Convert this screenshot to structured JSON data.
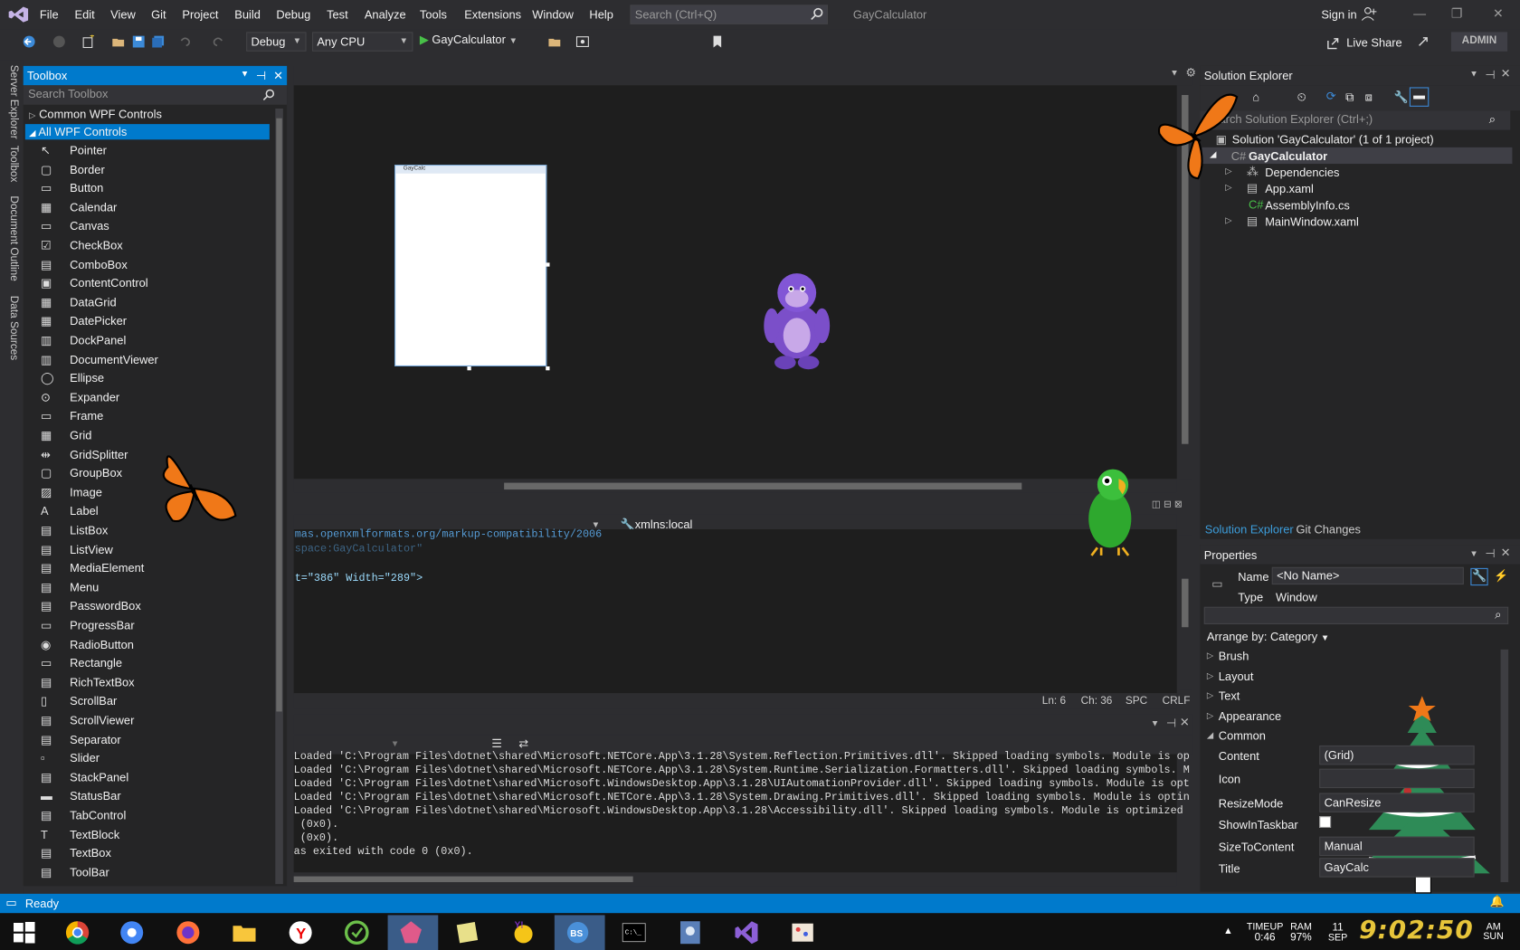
{
  "menu": [
    "File",
    "Edit",
    "View",
    "Git",
    "Project",
    "Build",
    "Debug",
    "Test",
    "Analyze",
    "Tools",
    "Extensions",
    "Window",
    "Help"
  ],
  "search_placeholder": "Search (Ctrl+Q)",
  "solution_name": "GayCalculator",
  "signin": "Sign in",
  "toolbar": {
    "config": "Debug",
    "platform": "Any CPU",
    "start": "GayCalculator",
    "liveshare": "Live Share",
    "user": "ADMIN"
  },
  "rail": [
    "Server Explorer",
    "Toolbox",
    "Document Outline",
    "Data Sources"
  ],
  "toolbox": {
    "title": "Toolbox",
    "search": "Search Toolbox",
    "cat_common": "Common WPF Controls",
    "cat_all": "All WPF Controls",
    "items": [
      "Pointer",
      "Border",
      "Button",
      "Calendar",
      "Canvas",
      "CheckBox",
      "ComboBox",
      "ContentControl",
      "DataGrid",
      "DatePicker",
      "DockPanel",
      "DocumentViewer",
      "Ellipse",
      "Expander",
      "Frame",
      "Grid",
      "GridSplitter",
      "GroupBox",
      "Image",
      "Label",
      "ListBox",
      "ListView",
      "MediaElement",
      "Menu",
      "PasswordBox",
      "ProgressBar",
      "RadioButton",
      "Rectangle",
      "RichTextBox",
      "ScrollBar",
      "ScrollViewer",
      "Separator",
      "Slider",
      "StackPanel",
      "StatusBar",
      "TabControl",
      "TextBlock",
      "TextBox",
      "ToolBar"
    ]
  },
  "designer": {
    "window_title": "GayCalc"
  },
  "xaml": {
    "scope": "xmlns:local",
    "line1": "mas.openxmlformats.org/markup-compatibility/2006",
    "line2": "space:GayCalculator\"",
    "line3a": "t=\"386\" ",
    "line3b": "Width=\"289\">",
    "ln": "Ln: 6",
    "ch": "Ch: 36",
    "spc": "SPC",
    "crlf": "CRLF"
  },
  "output": [
    "Loaded 'C:\\Program Files\\dotnet\\shared\\Microsoft.NETCore.App\\3.1.28\\System.Reflection.Primitives.dll'. Skipped loading symbols. Module is op",
    "Loaded 'C:\\Program Files\\dotnet\\shared\\Microsoft.NETCore.App\\3.1.28\\System.Runtime.Serialization.Formatters.dll'. Skipped loading symbols. M",
    "Loaded 'C:\\Program Files\\dotnet\\shared\\Microsoft.WindowsDesktop.App\\3.1.28\\UIAutomationProvider.dll'. Skipped loading symbols. Module is opt",
    "Loaded 'C:\\Program Files\\dotnet\\shared\\Microsoft.NETCore.App\\3.1.28\\System.Drawing.Primitives.dll'. Skipped loading symbols. Module is optin",
    "Loaded 'C:\\Program Files\\dotnet\\shared\\Microsoft.WindowsDesktop.App\\3.1.28\\Accessibility.dll'. Skipped loading symbols. Module is optimized",
    " (0x0).",
    " (0x0).",
    "as exited with code 0 (0x0)."
  ],
  "solution_explorer": {
    "title": "Solution Explorer",
    "search": "Search Solution Explorer (Ctrl+;)",
    "solution": "Solution 'GayCalculator' (1 of 1 project)",
    "project": "GayCalculator",
    "nodes": [
      "Dependencies",
      "App.xaml",
      "AssemblyInfo.cs",
      "MainWindow.xaml"
    ],
    "tab1": "Solution Explorer",
    "tab2": "Git Changes"
  },
  "properties": {
    "title": "Properties",
    "name_label": "Name",
    "name_value": "<No Name>",
    "type_label": "Type",
    "type_value": "Window",
    "arrange": "Arrange by: Category",
    "categories": [
      "Brush",
      "Layout",
      "Text",
      "Appearance",
      "Common"
    ],
    "rows": [
      {
        "label": "Content",
        "value": "(Grid)"
      },
      {
        "label": "Icon",
        "value": ""
      },
      {
        "label": "ResizeMode",
        "value": "CanResize"
      },
      {
        "label": "ShowInTaskbar",
        "value": ""
      },
      {
        "label": "SizeToContent",
        "value": "Manual"
      },
      {
        "label": "Title",
        "value": "GayCalc"
      }
    ]
  },
  "status": "Ready",
  "tray": {
    "timeup_label": "TIMEUP",
    "timeup": "0:46",
    "ram_label": "RAM",
    "ram": "97%",
    "day": "11",
    "month": "SEP",
    "clock": "9:02:50",
    "ampm": "AM",
    "weekday": "SUN"
  }
}
